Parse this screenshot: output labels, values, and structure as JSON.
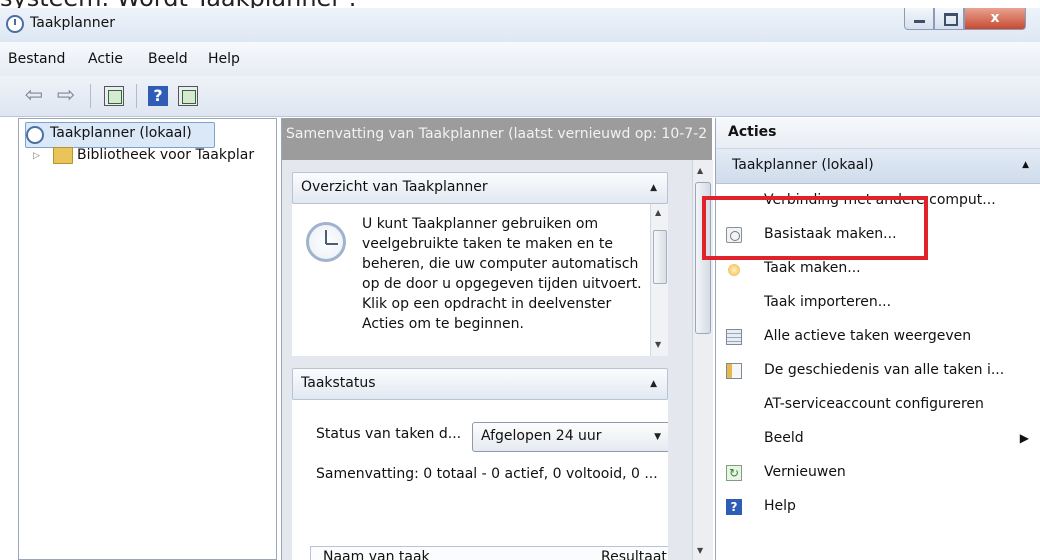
{
  "caption": "systeem. Wordt Taakplanner .",
  "window": {
    "title": "Taakplanner",
    "close_glyph": "x"
  },
  "menu": [
    "Bestand",
    "Actie",
    "Beeld",
    "Help"
  ],
  "toolbar": {
    "help_glyph": "?"
  },
  "tree": {
    "root": "Taakplanner (lokaal)",
    "child": "Bibliotheek voor Taakplar"
  },
  "middle": {
    "header": "Samenvatting van Taakplanner (laatst vernieuwd op: 10-7-2",
    "overview_title": "Overzicht van Taakplanner",
    "overview_text": "U kunt Taakplanner gebruiken om veelgebruikte taken te maken en te beheren, die uw computer automatisch op de door u opgegeven tijden uitvoert. Klik op een opdracht in deelvenster Acties om te beginnen.",
    "status_title": "Taakstatus",
    "status_label": "Status van taken d...",
    "status_value": "Afgelopen 24 uur",
    "summary": "Samenvatting: 0 totaal - 0 actief, 0 voltooid, 0 ...",
    "col_name": "Naam van taak",
    "col_result": "Resultaat"
  },
  "actions": {
    "title": "Acties",
    "section": "Taakplanner (lokaal)",
    "items": [
      {
        "label": "Verbinding met andere comput...",
        "icon": "none"
      },
      {
        "label": "Basistaak maken...",
        "icon": "basic-task-icon"
      },
      {
        "label": "Taak maken...",
        "icon": "create-task-icon"
      },
      {
        "label": "Taak importeren...",
        "icon": "none"
      },
      {
        "label": "Alle actieve taken weergeven",
        "icon": "running-tasks-icon"
      },
      {
        "label": "De geschiedenis van alle taken i...",
        "icon": "history-icon"
      },
      {
        "label": "AT-serviceaccount configureren",
        "icon": "none"
      },
      {
        "label": "Beeld",
        "icon": "none"
      },
      {
        "label": "Vernieuwen",
        "icon": "refresh-icon"
      },
      {
        "label": "Help",
        "icon": "help-icon"
      }
    ]
  },
  "colors": {
    "highlight": "#e0222a",
    "accent": "#2f5db6"
  }
}
